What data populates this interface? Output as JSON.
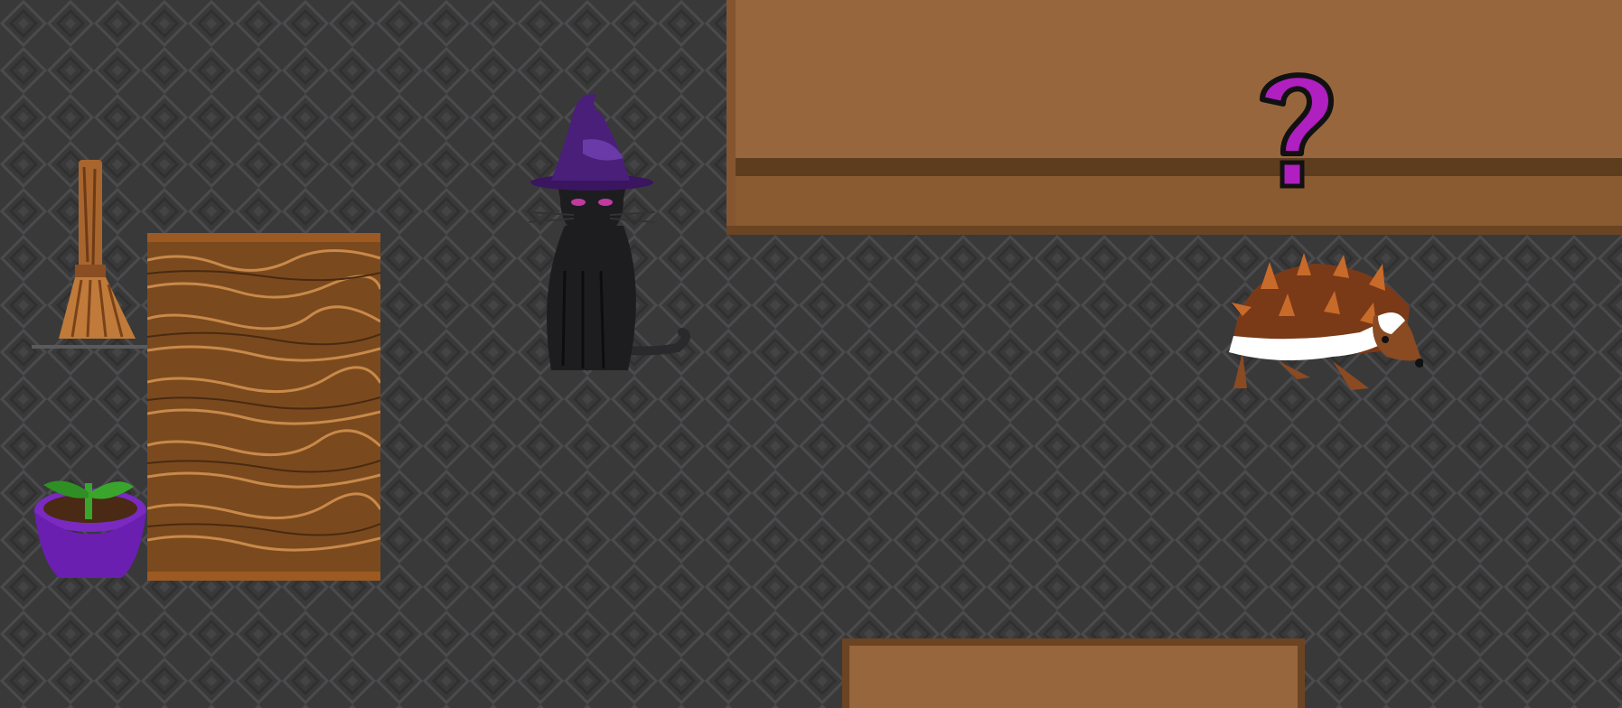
{
  "scene": {
    "floor": {
      "pattern": "diamond-tiles",
      "base_color": "#3a3a3b",
      "line_color": "#4a4a4c"
    },
    "counter_top": {
      "color": "#98663c",
      "edge_color": "#5e3d1e"
    },
    "counter_bottom": {
      "color": "#98663c",
      "edge_color": "#6b4423"
    },
    "rug": {
      "color": "#7a4a1e",
      "stripe_color": "#c9894a"
    },
    "broom": {
      "icon": "broom-icon",
      "color": "#c07a3a"
    },
    "plant_pot": {
      "icon": "potted-plant-icon",
      "pot_color": "#6a1fb0",
      "leaf_color": "#3aa52c"
    },
    "cat": {
      "icon": "witch-hat-cat-icon",
      "hat_color": "#4a1f7a",
      "body_color": "#1d1d1f",
      "eye_color": "#c03aa0"
    },
    "hedgehog": {
      "icon": "hedgehog-icon",
      "spine_color": "#7a3a18",
      "belly_color": "#ffffff"
    },
    "question_mark": {
      "icon": "question-mark-icon",
      "text": "?",
      "color": "#b01fc0"
    }
  }
}
